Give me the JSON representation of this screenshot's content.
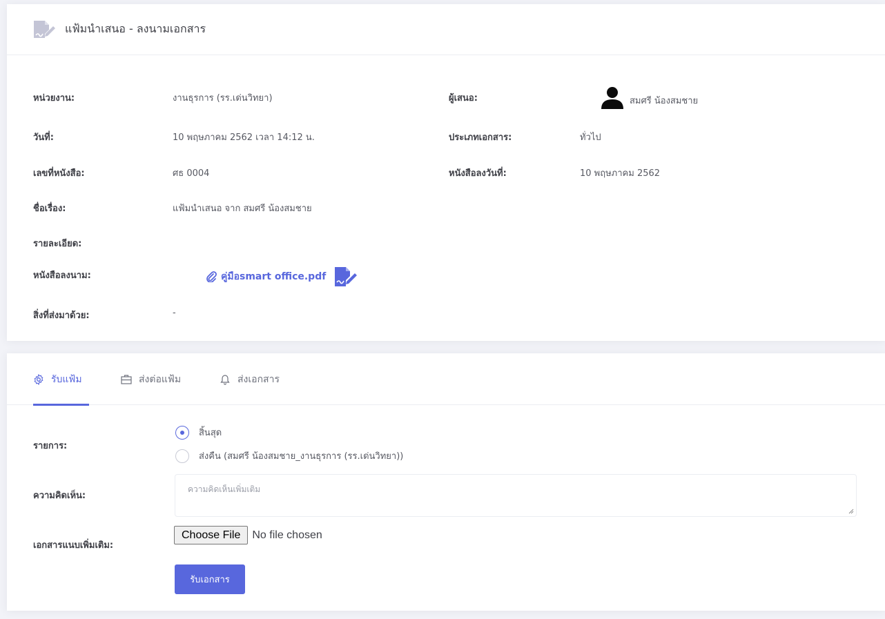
{
  "header": {
    "title": "แฟ้มนำเสนอ - ลงนามเอกสาร",
    "icon": "document-sign-icon"
  },
  "info": {
    "department_label": "หน่วยงาน:",
    "department_value": "งานธุรการ (รร.เด่นวิทยา)",
    "presenter_label": "ผู้เสนอ:",
    "presenter_value": "สมศรี น้องสมชาย",
    "date_label": "วันที่:",
    "date_value": "10 พฤษภาคม 2562 เวลา 14:12 น.",
    "doctype_label": "ประเภทเอกสาร:",
    "doctype_value": "ทั่วไป",
    "docno_label": "เลขที่หนังสือ:",
    "docno_value": "ศธ 0004",
    "docdate_label": "หนังสือลงวันที่:",
    "docdate_value": "10 พฤษภาคม 2562",
    "subject_label": "ชื่อเรื่อง:",
    "subject_value": "แฟ้มนำเสนอ จาก สมศรี น้องสมชาย",
    "detail_label": "รายละเอียด:",
    "signed_label": "หนังสือลงนาม:",
    "signed_file": "คู่มือsmart office.pdf",
    "enclosure_label": "สิ่งที่ส่งมาด้วย:",
    "enclosure_value": "-"
  },
  "tabs": [
    {
      "label": "รับแฟ้ม",
      "icon": "gear-icon",
      "active": true
    },
    {
      "label": "ส่งต่อแฟ้ม",
      "icon": "briefcase-icon",
      "active": false
    },
    {
      "label": "ส่งเอกสาร",
      "icon": "bell-icon",
      "active": false
    }
  ],
  "form": {
    "action_label": "รายการ:",
    "options": [
      {
        "label": "สิ้นสุด",
        "selected": true
      },
      {
        "label": "ส่งคืน (สมศรี น้องสมชาย_งานธุรการ (รร.เด่นวิทยา))",
        "selected": false
      }
    ],
    "comment_label": "ความคิดเห็น:",
    "comment_placeholder": "ความคิดเห็นเพิ่มเติม",
    "attach_label": "เอกสารแนบเพิ่มเติม:",
    "file_button": "Choose File",
    "file_status": "No file chosen",
    "submit_label": "รับเอกสาร"
  },
  "colors": {
    "accent": "#5867dd",
    "icon_gray": "#c4c5d6"
  }
}
